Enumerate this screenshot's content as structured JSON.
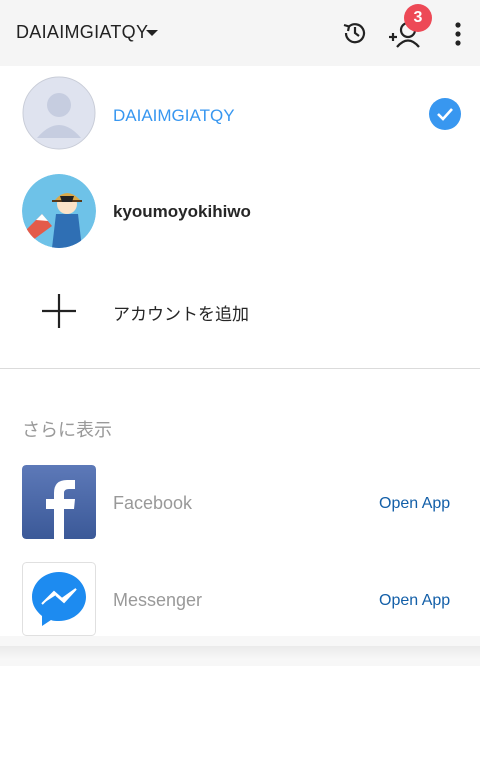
{
  "header": {
    "account_name": "DAIAIMGIATQY",
    "notification_count": "3"
  },
  "accounts": [
    {
      "username": "DAIAIMGIATQY",
      "selected": true,
      "color": "#3897f0"
    },
    {
      "username": "kyoumoyokihiwo",
      "selected": false,
      "color": "#262626"
    }
  ],
  "add_account_label": "アカウントを追加",
  "more_section": {
    "title": "さらに表示",
    "apps": [
      {
        "name": "Facebook",
        "action": "Open App",
        "icon": "facebook-icon"
      },
      {
        "name": "Messenger",
        "action": "Open App",
        "icon": "messenger-icon"
      }
    ]
  },
  "colors": {
    "accent": "#3897f0",
    "badge": "#ed4956",
    "link": "#135fa8"
  }
}
